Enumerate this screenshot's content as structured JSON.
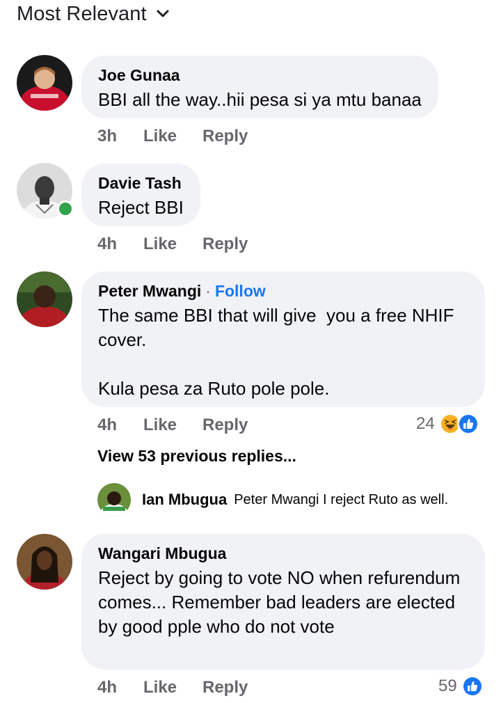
{
  "header": {
    "sort_label": "Most Relevant"
  },
  "comments": [
    {
      "author": "Joe Gunaa",
      "text": "BBI all the way..hii pesa si ya mtu banaa",
      "time": "3h",
      "like_label": "Like",
      "reply_label": "Reply"
    },
    {
      "author": "Davie Tash",
      "text": "Reject BBI",
      "time": "4h",
      "like_label": "Like",
      "reply_label": "Reply",
      "online": true
    },
    {
      "author": "Peter Mwangi",
      "follow_label": "Follow",
      "text": "The same BBI that will give  you a free NHIF cover.\n\nKula pesa za Ruto pole pole.",
      "time": "4h",
      "like_label": "Like",
      "reply_label": "Reply",
      "reaction_count": "24",
      "reaction_icons": [
        "haha-icon",
        "like-icon"
      ],
      "view_replies_label": "View 53 previous replies...",
      "reply": {
        "author": "Ian Mbugua",
        "text": "Peter Mwangi I reject Ruto as well."
      }
    },
    {
      "author": "Wangari Mbugua",
      "text": "Reject by going to vote NO when refurendum comes... Remember bad leaders are elected by good pple who do not vote",
      "time": "4h",
      "like_label": "Like",
      "reply_label": "Reply",
      "reaction_count": "59",
      "reaction_icons": [
        "like-icon"
      ]
    }
  ],
  "colors": {
    "bubble": "#f0f2f5",
    "meta": "#65676b",
    "link": "#1877f2",
    "online": "#31a24c",
    "haha": "#f7b125",
    "like": "#1877f2"
  }
}
